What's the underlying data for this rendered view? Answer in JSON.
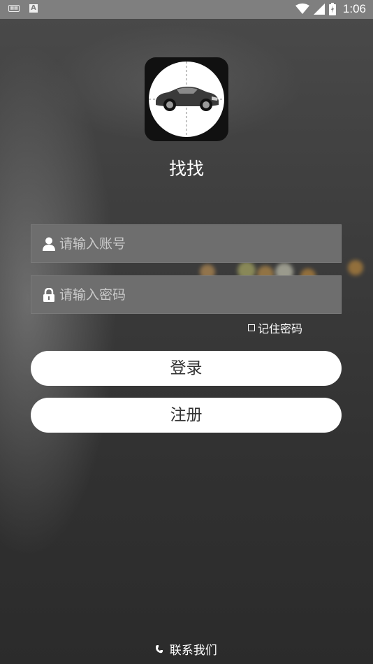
{
  "status_bar": {
    "time": "1:06",
    "icons": [
      "keyboard-icon",
      "a-icon",
      "wifi-icon",
      "signal-icon",
      "battery-icon"
    ]
  },
  "app": {
    "name": "找找",
    "logo": "car-in-crosshair-logo"
  },
  "login_form": {
    "account_placeholder": "请输入账号",
    "password_placeholder": "请输入密码",
    "remember_label": "记住密码",
    "login_label": "登录",
    "register_label": "注册"
  },
  "footer": {
    "contact_label": "联系我们",
    "contact_icon": "phone-icon"
  }
}
